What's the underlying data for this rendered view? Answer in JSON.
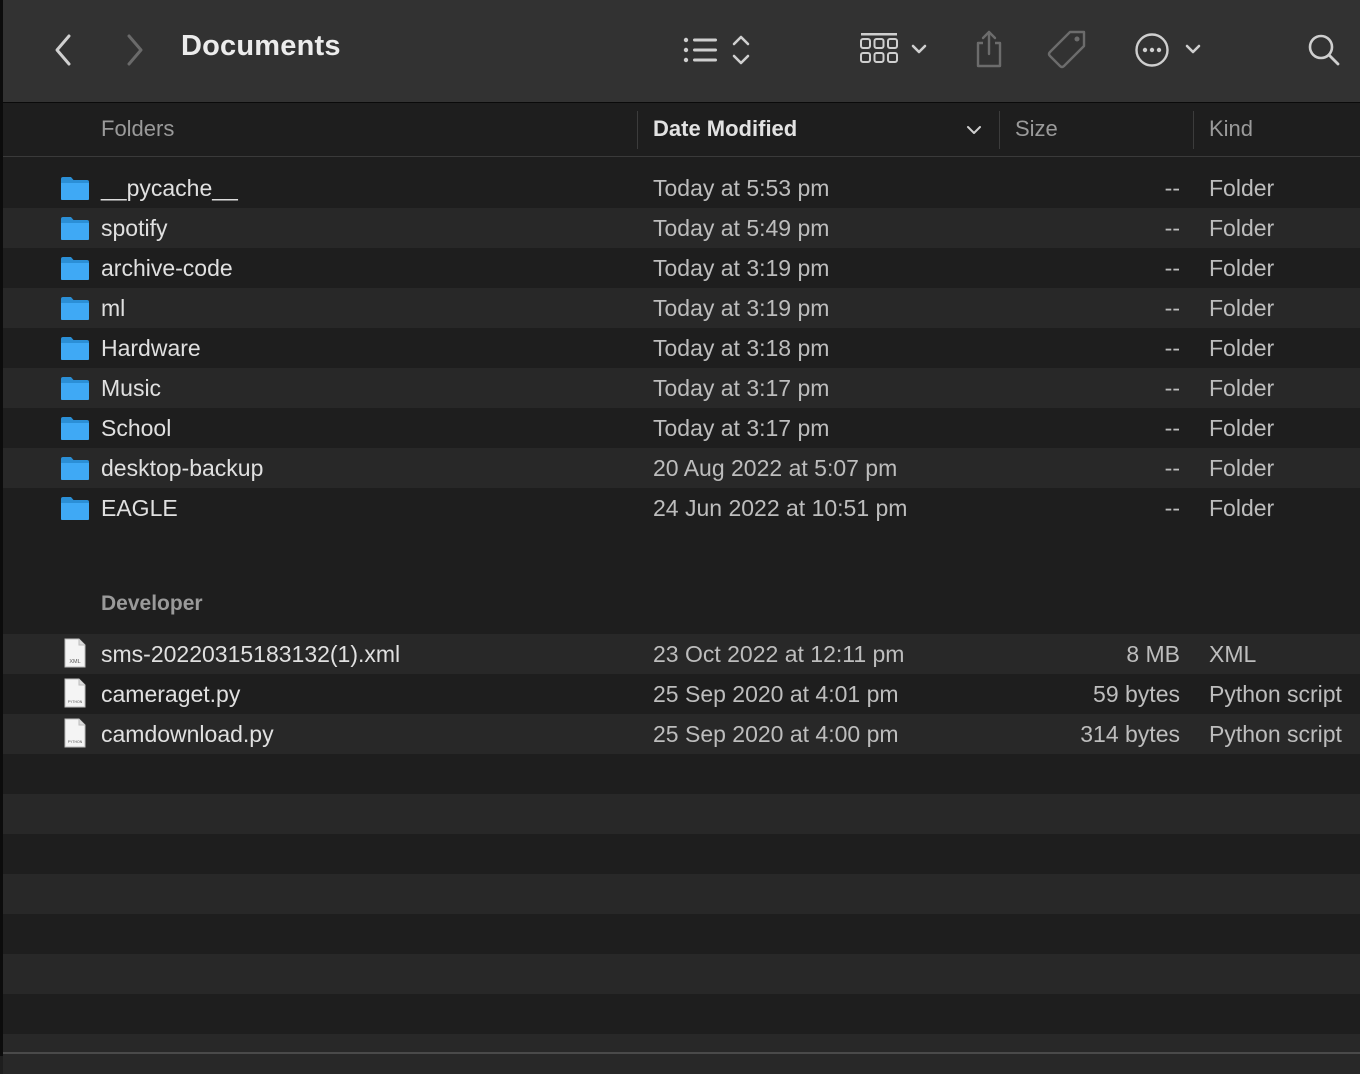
{
  "window": {
    "title": "Documents"
  },
  "toolbar": {
    "back_icon": "chevron-left-icon",
    "forward_icon": "chevron-right-icon",
    "list_view_icon": "list-view-icon",
    "group_icon": "grid-group-icon",
    "share_icon": "share-icon",
    "tag_icon": "tag-icon",
    "more_icon": "ellipsis-circle-icon",
    "search_icon": "search-icon"
  },
  "columns": {
    "name": "Folders",
    "date": "Date Modified",
    "size": "Size",
    "kind": "Kind"
  },
  "folders": [
    {
      "name": "__pycache__",
      "date": "Today at 5:53 pm",
      "size": "--",
      "kind": "Folder"
    },
    {
      "name": "spotify",
      "date": "Today at 5:49 pm",
      "size": "--",
      "kind": "Folder"
    },
    {
      "name": "archive-code",
      "date": "Today at 3:19 pm",
      "size": "--",
      "kind": "Folder"
    },
    {
      "name": "ml",
      "date": "Today at 3:19 pm",
      "size": "--",
      "kind": "Folder"
    },
    {
      "name": "Hardware",
      "date": "Today at 3:18 pm",
      "size": "--",
      "kind": "Folder"
    },
    {
      "name": "Music",
      "date": "Today at 3:17 pm",
      "size": "--",
      "kind": "Folder"
    },
    {
      "name": "School",
      "date": "Today at 3:17 pm",
      "size": "--",
      "kind": "Folder"
    },
    {
      "name": "desktop-backup",
      "date": "20 Aug 2022 at 5:07 pm",
      "size": "--",
      "kind": "Folder"
    },
    {
      "name": "EAGLE",
      "date": "24 Jun 2022 at 10:51 pm",
      "size": "--",
      "kind": "Folder"
    }
  ],
  "developer_section": {
    "label": "Developer",
    "files": [
      {
        "name": "sms-20220315183132(1).xml",
        "date": "23 Oct 2022 at 12:11 pm",
        "size": "8 MB",
        "kind": "XML",
        "icon_label": "XML"
      },
      {
        "name": "cameraget.py",
        "date": "25 Sep 2020 at 4:01 pm",
        "size": "59 bytes",
        "kind": "Python script",
        "icon_label": "PYTHON"
      },
      {
        "name": "camdownload.py",
        "date": "25 Sep 2020 at 4:00 pm",
        "size": "314 bytes",
        "kind": "Python script",
        "icon_label": "PYTHON"
      }
    ]
  },
  "colors": {
    "folder_blue": "#3fa9f5",
    "background": "#1e1e1e",
    "row_alt": "#282828",
    "toolbar": "#323232"
  }
}
